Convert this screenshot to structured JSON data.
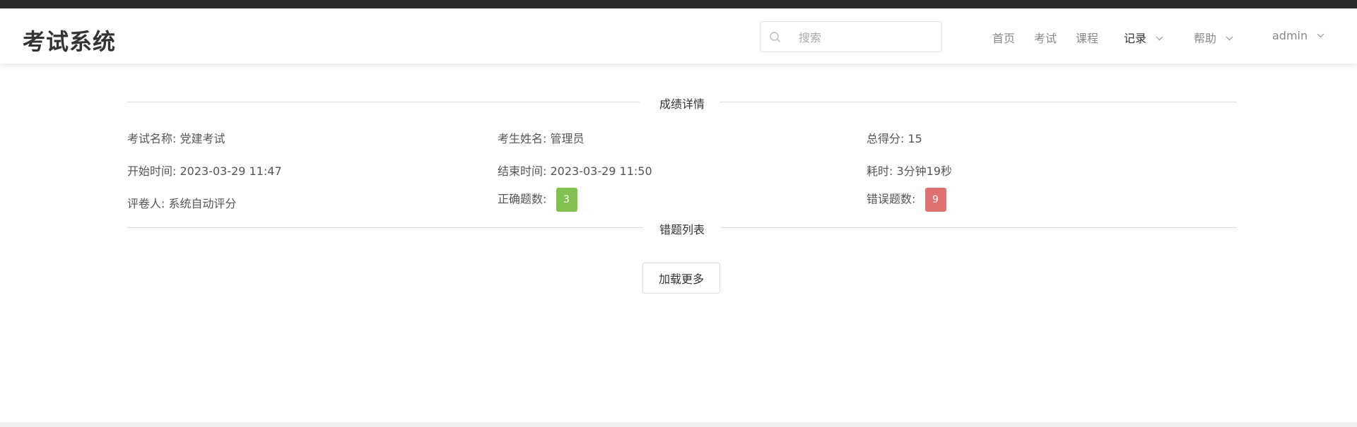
{
  "app": {
    "title": "考试系统"
  },
  "search": {
    "placeholder": "搜索"
  },
  "nav": {
    "home": "首页",
    "exam": "考试",
    "course": "课程",
    "records": "记录",
    "help": "帮助",
    "user": "admin"
  },
  "icons": {
    "search": "search-icon",
    "dropdown": "chevron-down-icon"
  },
  "colors": {
    "correct_badge": "#82c14f",
    "wrong_badge": "#e07070"
  },
  "score_detail": {
    "section_title": "成绩详情",
    "exam_name": "考试名称: 党建考试",
    "examinee_name": "考生姓名: 管理员",
    "total_score": "总得分: 15",
    "start_time": "开始时间: 2023-03-29 11:47",
    "end_time": "结束时间: 2023-03-29 11:50",
    "duration": "耗时: 3分钟19秒",
    "grader": "评卷人: 系统自动评分",
    "correct_label": "正确题数:",
    "correct_count": "3",
    "wrong_label": "错误题数:",
    "wrong_count": "9"
  },
  "wrong_list": {
    "section_title": "错题列表",
    "load_more": "加载更多"
  }
}
